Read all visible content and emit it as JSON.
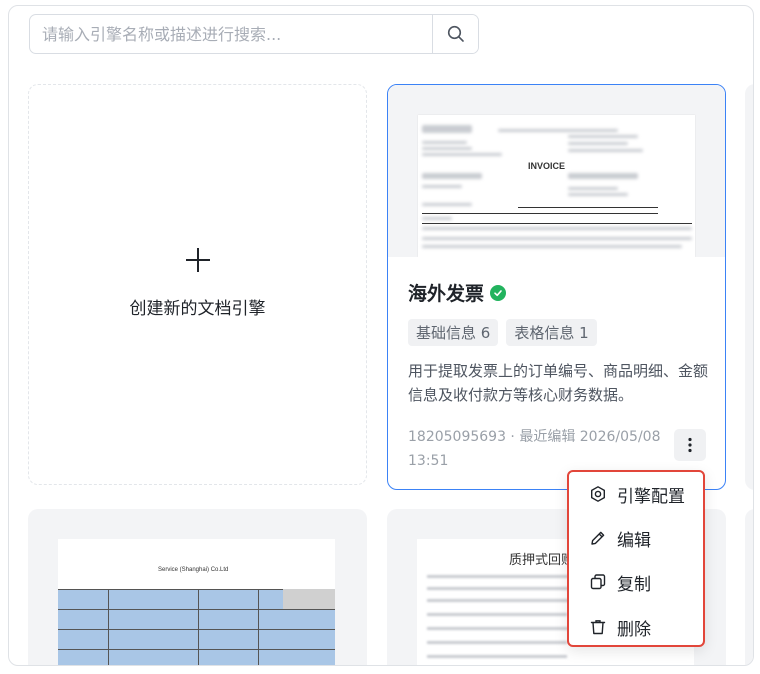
{
  "search": {
    "placeholder": "请输入引擎名称或描述进行搜索...",
    "button_icon": "search-icon"
  },
  "create_card": {
    "icon": "plus-icon",
    "label": "创建新的文档引擎"
  },
  "engine_card": {
    "preview_heading": "INVOICE",
    "title": "海外发票",
    "status_icon": "check-circle-icon",
    "status_color": "#22b35e",
    "tags": [
      "基础信息 6",
      "表格信息 1"
    ],
    "description": "用于提取发票上的订单编号、商品明细、金额信息及收付款方等核心财务数据。",
    "meta": "18205095693 · 最近编辑 2026/05/08 13:51",
    "more_icon": "more-vertical-icon"
  },
  "context_menu": {
    "highlight_color": "#e2463a",
    "items": [
      {
        "label": "引擎配置",
        "icon": "gear-icon"
      },
      {
        "label": "编辑",
        "icon": "pencil-icon"
      },
      {
        "label": "复制",
        "icon": "copy-icon"
      },
      {
        "label": "删除",
        "icon": "trash-icon"
      }
    ]
  },
  "bottom_cards": {
    "left_preview_text": "Service (Shanghai) Co.Ltd",
    "right_preview_title": "质押式回购"
  },
  "colors": {
    "active_border": "#3b82f6",
    "thumbnail_bg": "#f3f4f6"
  }
}
